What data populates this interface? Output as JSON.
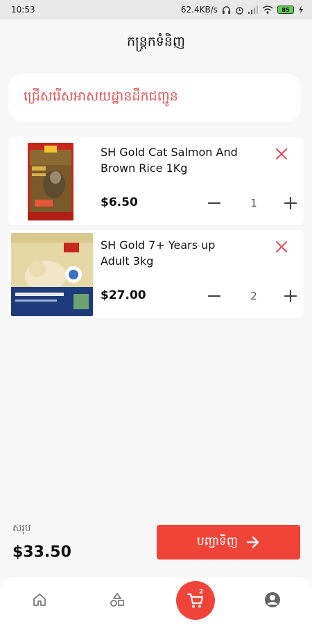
{
  "status_bar": {
    "time": "10:53",
    "network_speed": "62.4KB/s",
    "battery": "85"
  },
  "header": {
    "title": "កន្ត្រកទំនិញ"
  },
  "address": {
    "prompt": "ជ្រើសរើសអាសយដ្ឋានដឹកជញ្ជូន"
  },
  "cart": {
    "items": [
      {
        "name": "SH Gold Cat Salmon And Brown Rice 1Kg",
        "price": "$6.50",
        "quantity": "1"
      },
      {
        "name": "SH Gold 7+ Years up Adult 3kg",
        "price": "$27.00",
        "quantity": "2"
      }
    ]
  },
  "summary": {
    "total_label": "សរុប",
    "total_value": "$33.50",
    "checkout_label": "បញ្ជាទិញ"
  },
  "bottom_nav": {
    "cart_badge": "2",
    "items": [
      "home-icon",
      "categories-icon",
      "cart-icon",
      "profile-icon"
    ]
  },
  "colors": {
    "accent": "#f04438",
    "remove": "#e0555a",
    "background": "#f7f7f7"
  }
}
